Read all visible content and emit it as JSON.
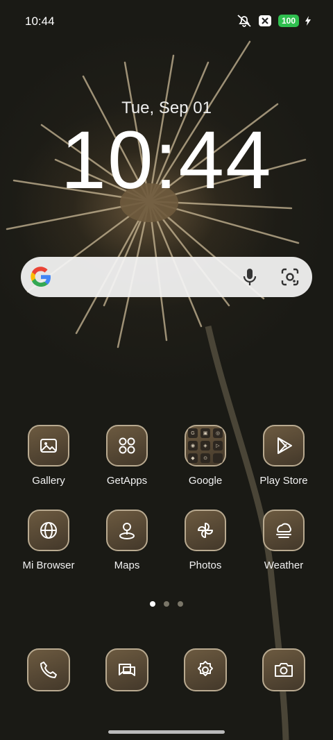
{
  "status": {
    "time": "10:44",
    "battery": "100",
    "icons": [
      "mute-icon",
      "close-box-icon",
      "charging-icon"
    ]
  },
  "lockscreen": {
    "date": "Tue, Sep 01",
    "clock": "10:44"
  },
  "search": {
    "icons": [
      "google-g-icon",
      "microphone-icon",
      "lens-camera-icon"
    ]
  },
  "apps": [
    {
      "label": "Gallery",
      "icon": "gallery-icon"
    },
    {
      "label": "GetApps",
      "icon": "getapps-icon"
    },
    {
      "label": "Google",
      "icon": "google-folder-icon"
    },
    {
      "label": "Play Store",
      "icon": "play-store-icon"
    },
    {
      "label": "Mi Browser",
      "icon": "globe-icon"
    },
    {
      "label": "Maps",
      "icon": "maps-pin-icon"
    },
    {
      "label": "Photos",
      "icon": "pinwheel-icon"
    },
    {
      "label": "Weather",
      "icon": "weather-icon"
    }
  ],
  "pages": {
    "count": 3,
    "active": 1
  },
  "dock": [
    {
      "name": "phone",
      "icon": "phone-icon"
    },
    {
      "name": "messages",
      "icon": "messages-icon"
    },
    {
      "name": "settings",
      "icon": "settings-gear-icon"
    },
    {
      "name": "camera",
      "icon": "camera-icon"
    }
  ]
}
